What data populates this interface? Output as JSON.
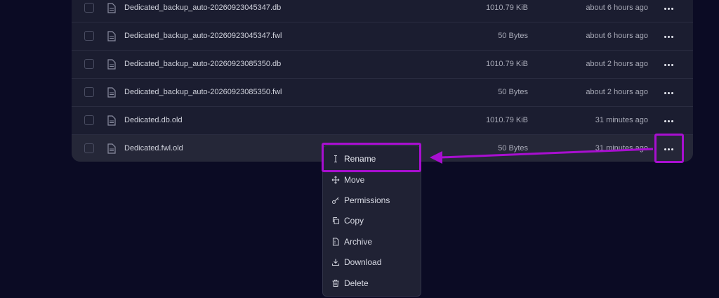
{
  "files": [
    {
      "name": "Dedicated_backup_auto-20260923045347.db",
      "size": "1010.79 KiB",
      "modified": "about 6 hours ago"
    },
    {
      "name": "Dedicated_backup_auto-20260923045347.fwl",
      "size": "50 Bytes",
      "modified": "about 6 hours ago"
    },
    {
      "name": "Dedicated_backup_auto-20260923085350.db",
      "size": "1010.79 KiB",
      "modified": "about 2 hours ago"
    },
    {
      "name": "Dedicated_backup_auto-20260923085350.fwl",
      "size": "50 Bytes",
      "modified": "about 2 hours ago"
    },
    {
      "name": "Dedicated.db.old",
      "size": "1010.79 KiB",
      "modified": "31 minutes ago"
    },
    {
      "name": "Dedicated.fwl.old",
      "size": "50 Bytes",
      "modified": "31 minutes ago"
    }
  ],
  "context_menu": {
    "items": [
      {
        "label": "Rename",
        "icon": "text-cursor-icon"
      },
      {
        "label": "Move",
        "icon": "move-arrows-icon"
      },
      {
        "label": "Permissions",
        "icon": "key-icon"
      },
      {
        "label": "Copy",
        "icon": "copy-icon"
      },
      {
        "label": "Archive",
        "icon": "archive-file-icon"
      },
      {
        "label": "Download",
        "icon": "download-icon"
      },
      {
        "label": "Delete",
        "icon": "trash-icon"
      }
    ]
  },
  "pagination_hint": "6",
  "colors": {
    "background": "#0b0b24",
    "table_bg": "#1b1d30",
    "highlight": "#a80fd0",
    "menu_bg": "#202234"
  }
}
